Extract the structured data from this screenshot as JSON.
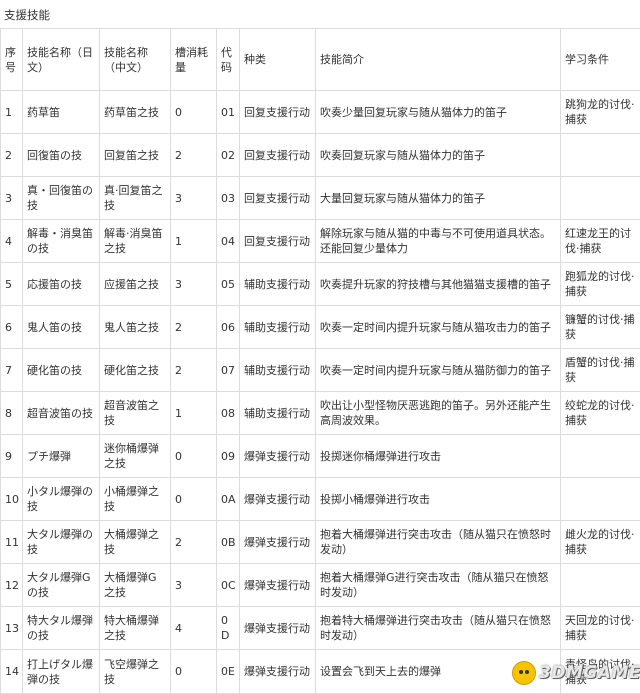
{
  "caption": "支援技能",
  "headers": {
    "num": "序号",
    "name_jp": "技能名称（日文）",
    "name_cn": "技能名称（中文）",
    "slots": "槽消耗量",
    "code": "代码",
    "type": "种类",
    "desc": "技能简介",
    "condition": "学习条件"
  },
  "rows": [
    {
      "num": "1",
      "name_jp": "药草笛",
      "name_cn": "药草笛之技",
      "slots": "0",
      "code": "01",
      "type": "回复支援行动",
      "desc": "吹奏少量回复玩家与随从猫体力的笛子",
      "condition": "跳狗龙的讨伐·捕获"
    },
    {
      "num": "2",
      "name_jp": "回復笛の技",
      "name_cn": "回复笛之技",
      "slots": "2",
      "code": "02",
      "type": "回复支援行动",
      "desc": "吹奏回复玩家与随从猫体力的笛子",
      "condition": ""
    },
    {
      "num": "3",
      "name_jp": "真・回復笛の技",
      "name_cn": "真·回复笛之技",
      "slots": "3",
      "code": "03",
      "type": "回复支援行动",
      "desc": "大量回复玩家与随从猫体力的笛子",
      "condition": ""
    },
    {
      "num": "4",
      "name_jp": "解毒・消臭笛の技",
      "name_cn": "解毒·消臭笛之技",
      "slots": "1",
      "code": "04",
      "type": "回复支援行动",
      "desc": "解除玩家与随从猫的中毒与不可使用道具状态。还能回复少量体力",
      "condition": "红速龙王的讨伐·捕获"
    },
    {
      "num": "5",
      "name_jp": "応援笛の技",
      "name_cn": "应援笛之技",
      "slots": "3",
      "code": "05",
      "type": "辅助支援行动",
      "desc": "吹奏提升玩家的狩技槽与其他猫猫支援槽的笛子",
      "condition": "跑狐龙的讨伐·捕获"
    },
    {
      "num": "6",
      "name_jp": "鬼人笛の技",
      "name_cn": "鬼人笛之技",
      "slots": "2",
      "code": "06",
      "type": "辅助支援行动",
      "desc": "吹奏一定时间内提升玩家与随从猫攻击力的笛子",
      "condition": "镰蟹的讨伐·捕获"
    },
    {
      "num": "7",
      "name_jp": "硬化笛の技",
      "name_cn": "硬化笛之技",
      "slots": "2",
      "code": "07",
      "type": "辅助支援行动",
      "desc": "吹奏一定时间内提升玩家与随从猫防御力的笛子",
      "condition": "盾蟹的讨伐·捕获"
    },
    {
      "num": "8",
      "name_jp": "超音波笛の技",
      "name_cn": "超音波笛之技",
      "slots": "1",
      "code": "08",
      "type": "辅助支援行动",
      "desc": "吹出让小型怪物厌恶逃跑的笛子。另外还能产生高周波效果。",
      "condition": "绞蛇龙的讨伐·捕获"
    },
    {
      "num": "9",
      "name_jp": "プチ爆弾",
      "name_cn": "迷你桶爆弹之技",
      "slots": "0",
      "code": "09",
      "type": "爆弹支援行动",
      "desc": "投掷迷你桶爆弹进行攻击",
      "condition": ""
    },
    {
      "num": "10",
      "name_jp": "小タル爆弾の技",
      "name_cn": "小桶爆弹之技",
      "slots": "0",
      "code": "0A",
      "type": "爆弹支援行动",
      "desc": "投掷小桶爆弹进行攻击",
      "condition": ""
    },
    {
      "num": "11",
      "name_jp": "大タル爆弾の技",
      "name_cn": "大桶爆弹之技",
      "slots": "2",
      "code": "0B",
      "type": "爆弹支援行动",
      "desc": "抱着大桶爆弹进行突击攻击（随从猫只在愤怒时发动）",
      "condition": "雌火龙的讨伐·捕获"
    },
    {
      "num": "12",
      "name_jp": "大タル爆弾Gの技",
      "name_cn": "大桶爆弹G之技",
      "slots": "3",
      "code": "0C",
      "type": "爆弹支援行动",
      "desc": "抱着大桶爆弹G进行突击攻击（随从猫只在愤怒时发动）",
      "condition": ""
    },
    {
      "num": "13",
      "name_jp": "特大タル爆弾の技",
      "name_cn": "特大桶爆弹之技",
      "slots": "4",
      "code": "0D",
      "type": "爆弹支援行动",
      "desc": "抱着特大桶爆弹进行突击攻击（随从猫只在愤怒时发动）",
      "condition": "天回龙的讨伐·捕获"
    },
    {
      "num": "14",
      "name_jp": "打上げタル爆弾の技",
      "name_cn": "飞空爆弹之技",
      "slots": "0",
      "code": "0E",
      "type": "爆弹支援行动",
      "desc": "设置会飞到天上去的爆弹",
      "condition": "毒怪鸟的讨伐·捕获"
    }
  ],
  "watermark": "3DMGAME"
}
